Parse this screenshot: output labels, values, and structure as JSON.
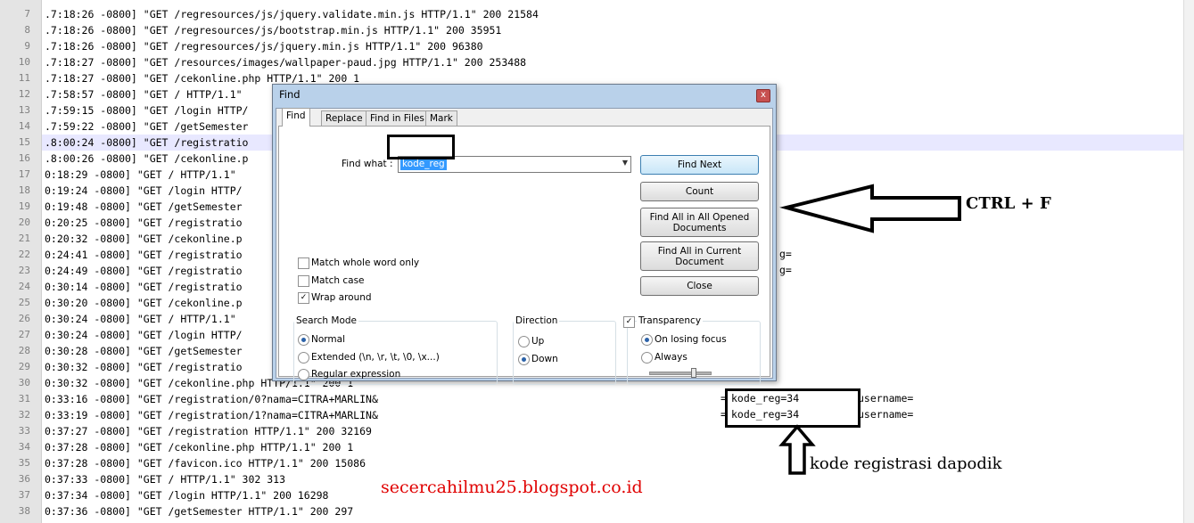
{
  "editor": {
    "lines": [
      {
        "n": "7",
        "text": ".7:18:26 -0800] \"GET /regresources/js/jquery.validate.min.js HTTP/1.1\" 200 21584"
      },
      {
        "n": "8",
        "text": ".7:18:26 -0800] \"GET /regresources/js/bootstrap.min.js HTTP/1.1\" 200 35951"
      },
      {
        "n": "9",
        "text": ".7:18:26 -0800] \"GET /regresources/js/jquery.min.js HTTP/1.1\" 200 96380"
      },
      {
        "n": "10",
        "text": ".7:18:27 -0800] \"GET /resources/images/wallpaper-paud.jpg HTTP/1.1\" 200 253488"
      },
      {
        "n": "11",
        "text": ".7:18:27 -0800] \"GET /cekonline.php HTTP/1.1\" 200 1"
      },
      {
        "n": "12",
        "text": ".7:58:57 -0800] \"GET / HTTP/1.1\""
      },
      {
        "n": "13",
        "text": ".7:59:15 -0800] \"GET /login HTTP/"
      },
      {
        "n": "14",
        "text": ".7:59:22 -0800] \"GET /getSemester"
      },
      {
        "n": "15",
        "text": ".8:00:24 -0800] \"GET /registratio"
      },
      {
        "n": "16",
        "text": ".8:00:26 -0800] \"GET /cekonline.p"
      },
      {
        "n": "17",
        "text": "0:18:29 -0800] \"GET / HTTP/1.1\""
      },
      {
        "n": "18",
        "text": "0:19:24 -0800] \"GET /login HTTP/"
      },
      {
        "n": "19",
        "text": "0:19:48 -0800] \"GET /getSemester"
      },
      {
        "n": "20",
        "text": "0:20:25 -0800] \"GET /registratio"
      },
      {
        "n": "21",
        "text": "0:20:32 -0800] \"GET /cekonline.p"
      },
      {
        "n": "22",
        "text": "0:24:41 -0800] \"GET /registratio"
      },
      {
        "n": "23",
        "text": "0:24:49 -0800] \"GET /registratio"
      },
      {
        "n": "24",
        "text": "0:30:14 -0800] \"GET /registratio"
      },
      {
        "n": "25",
        "text": "0:30:20 -0800] \"GET /cekonline.p"
      },
      {
        "n": "26",
        "text": "0:30:24 -0800] \"GET / HTTP/1.1\""
      },
      {
        "n": "27",
        "text": "0:30:24 -0800] \"GET /login HTTP/"
      },
      {
        "n": "28",
        "text": "0:30:28 -0800] \"GET /getSemester"
      },
      {
        "n": "29",
        "text": "0:30:32 -0800] \"GET /registratio"
      },
      {
        "n": "30",
        "text": "0:30:32 -0800] \"GET /cekonline.php HTTP/1.1\" 200 1"
      },
      {
        "n": "31",
        "text": "0:33:16 -0800] \"GET /registration/0?nama=CITRA+MARLIN&"
      },
      {
        "n": "32",
        "text": "0:33:19 -0800] \"GET /registration/1?nama=CITRA+MARLIN&"
      },
      {
        "n": "33",
        "text": "0:37:27 -0800] \"GET /registration HTTP/1.1\" 200 32169"
      },
      {
        "n": "34",
        "text": "0:37:28 -0800] \"GET /cekonline.php HTTP/1.1\" 200 1"
      },
      {
        "n": "35",
        "text": "0:37:28 -0800] \"GET /favicon.ico HTTP/1.1\" 200 15086"
      },
      {
        "n": "36",
        "text": "0:37:33 -0800] \"GET / HTTP/1.1\" 302 313"
      },
      {
        "n": "37",
        "text": "0:37:34 -0800] \"GET /login HTTP/1.1\" 200 16298"
      },
      {
        "n": "38",
        "text": "0:37:36 -0800] \"GET /getSemester HTTP/1.1\" 200 297"
      }
    ],
    "frag_22": "g=",
    "frag_23": "g=",
    "frag_31a": "=",
    "frag_31b": "kode_reg=34",
    "frag_31c": "username=",
    "frag_32a": "=",
    "frag_32b": "kode_reg=34",
    "frag_32c": "username="
  },
  "dialog": {
    "title": "Find",
    "close": "x",
    "tabs": [
      "Find",
      "Replace",
      "Find in Files",
      "Mark"
    ],
    "find_what_label": "Find what :",
    "find_what_value": "kode_reg",
    "buttons": {
      "find_next": "Find Next",
      "count": "Count",
      "find_all_opened": "Find All in All Opened Documents",
      "find_all_current": "Find All in Current Document",
      "close": "Close"
    },
    "options": {
      "match_whole_word": "Match whole word only",
      "match_case": "Match case",
      "wrap_around": "Wrap around"
    },
    "search_mode": {
      "title": "Search Mode",
      "normal": "Normal",
      "extended": "Extended (\\n, \\r, \\t, \\0, \\x...)",
      "regex": "Regular expression"
    },
    "direction": {
      "title": "Direction",
      "up": "Up",
      "down": "Down"
    },
    "transparency": {
      "title": "Transparency",
      "on_losing_focus": "On losing focus",
      "always": "Always"
    }
  },
  "annotations": {
    "shortcut": "CTRL + F",
    "caption": "kode registrasi dapodik",
    "watermark": "secercahilmu25.blogspot.co.id"
  },
  "colors": {
    "watermark": "#e00000",
    "highlight_line": "#e8e8ff",
    "selection": "#3399ff",
    "gutter": "#e4e4e4"
  }
}
